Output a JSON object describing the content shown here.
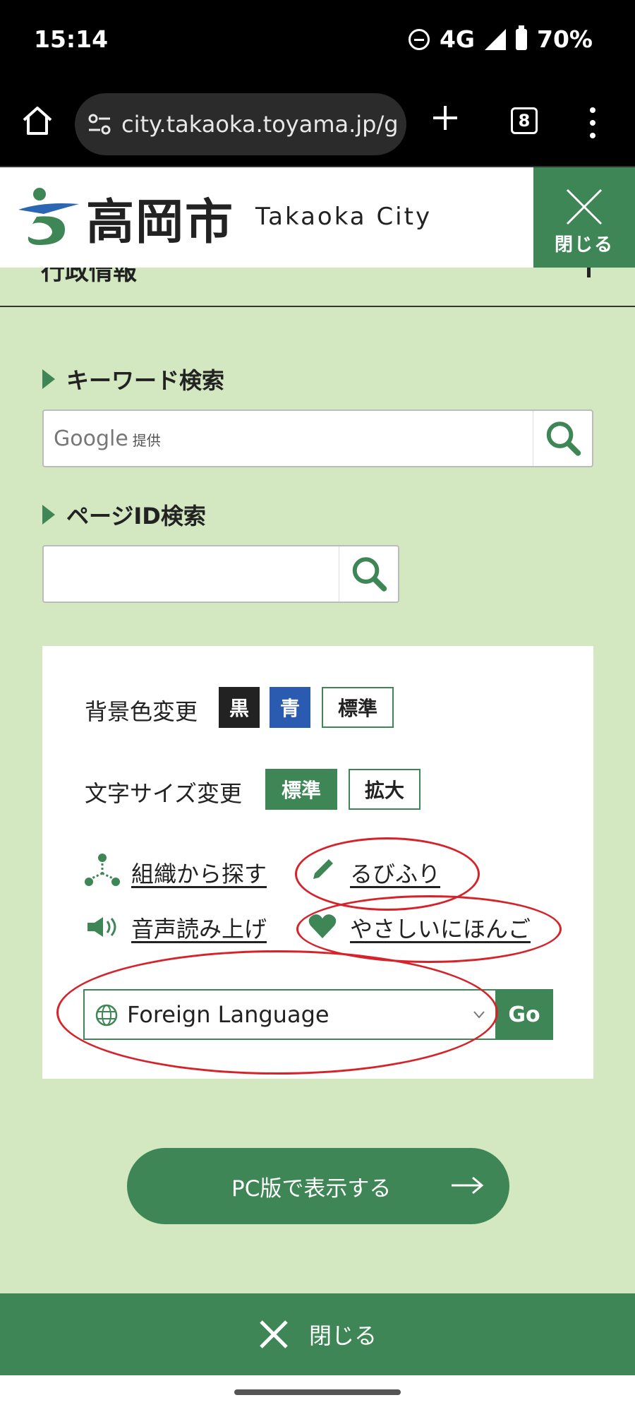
{
  "status_bar": {
    "time": "15:14",
    "network": "4G",
    "battery": "70%"
  },
  "browser": {
    "url": "city.takaoka.toyama.jp/g",
    "tab_count": "8"
  },
  "header": {
    "logo_text": "高岡市",
    "logo_english": "Takaoka City",
    "close_label": "閉じる"
  },
  "cut_section": {
    "text": "行政情報"
  },
  "keyword_search": {
    "title": "キーワード検索",
    "placeholder_brand": "Google",
    "placeholder_suffix": "提供"
  },
  "page_id_search": {
    "title": "ページID検索"
  },
  "settings": {
    "bg_color_label": "背景色変更",
    "bg_black": "黒",
    "bg_blue": "青",
    "bg_standard": "標準",
    "font_size_label": "文字サイズ変更",
    "font_standard": "標準",
    "font_large": "拡大",
    "links": {
      "org_search": "組織から探す",
      "ruby": "るびふり",
      "speech": "音声読み上げ",
      "easy_japanese": "やさしいにほんご"
    },
    "language_select": "Foreign Language",
    "go_button": "Go"
  },
  "pc_view_button": "PC版で表示する",
  "bottom_close": "閉じる",
  "colors": {
    "brand_green": "#3e8656",
    "page_bg": "#d3e8c1",
    "annotation_red": "#d6232a",
    "blue_button": "#2b5bb0"
  }
}
